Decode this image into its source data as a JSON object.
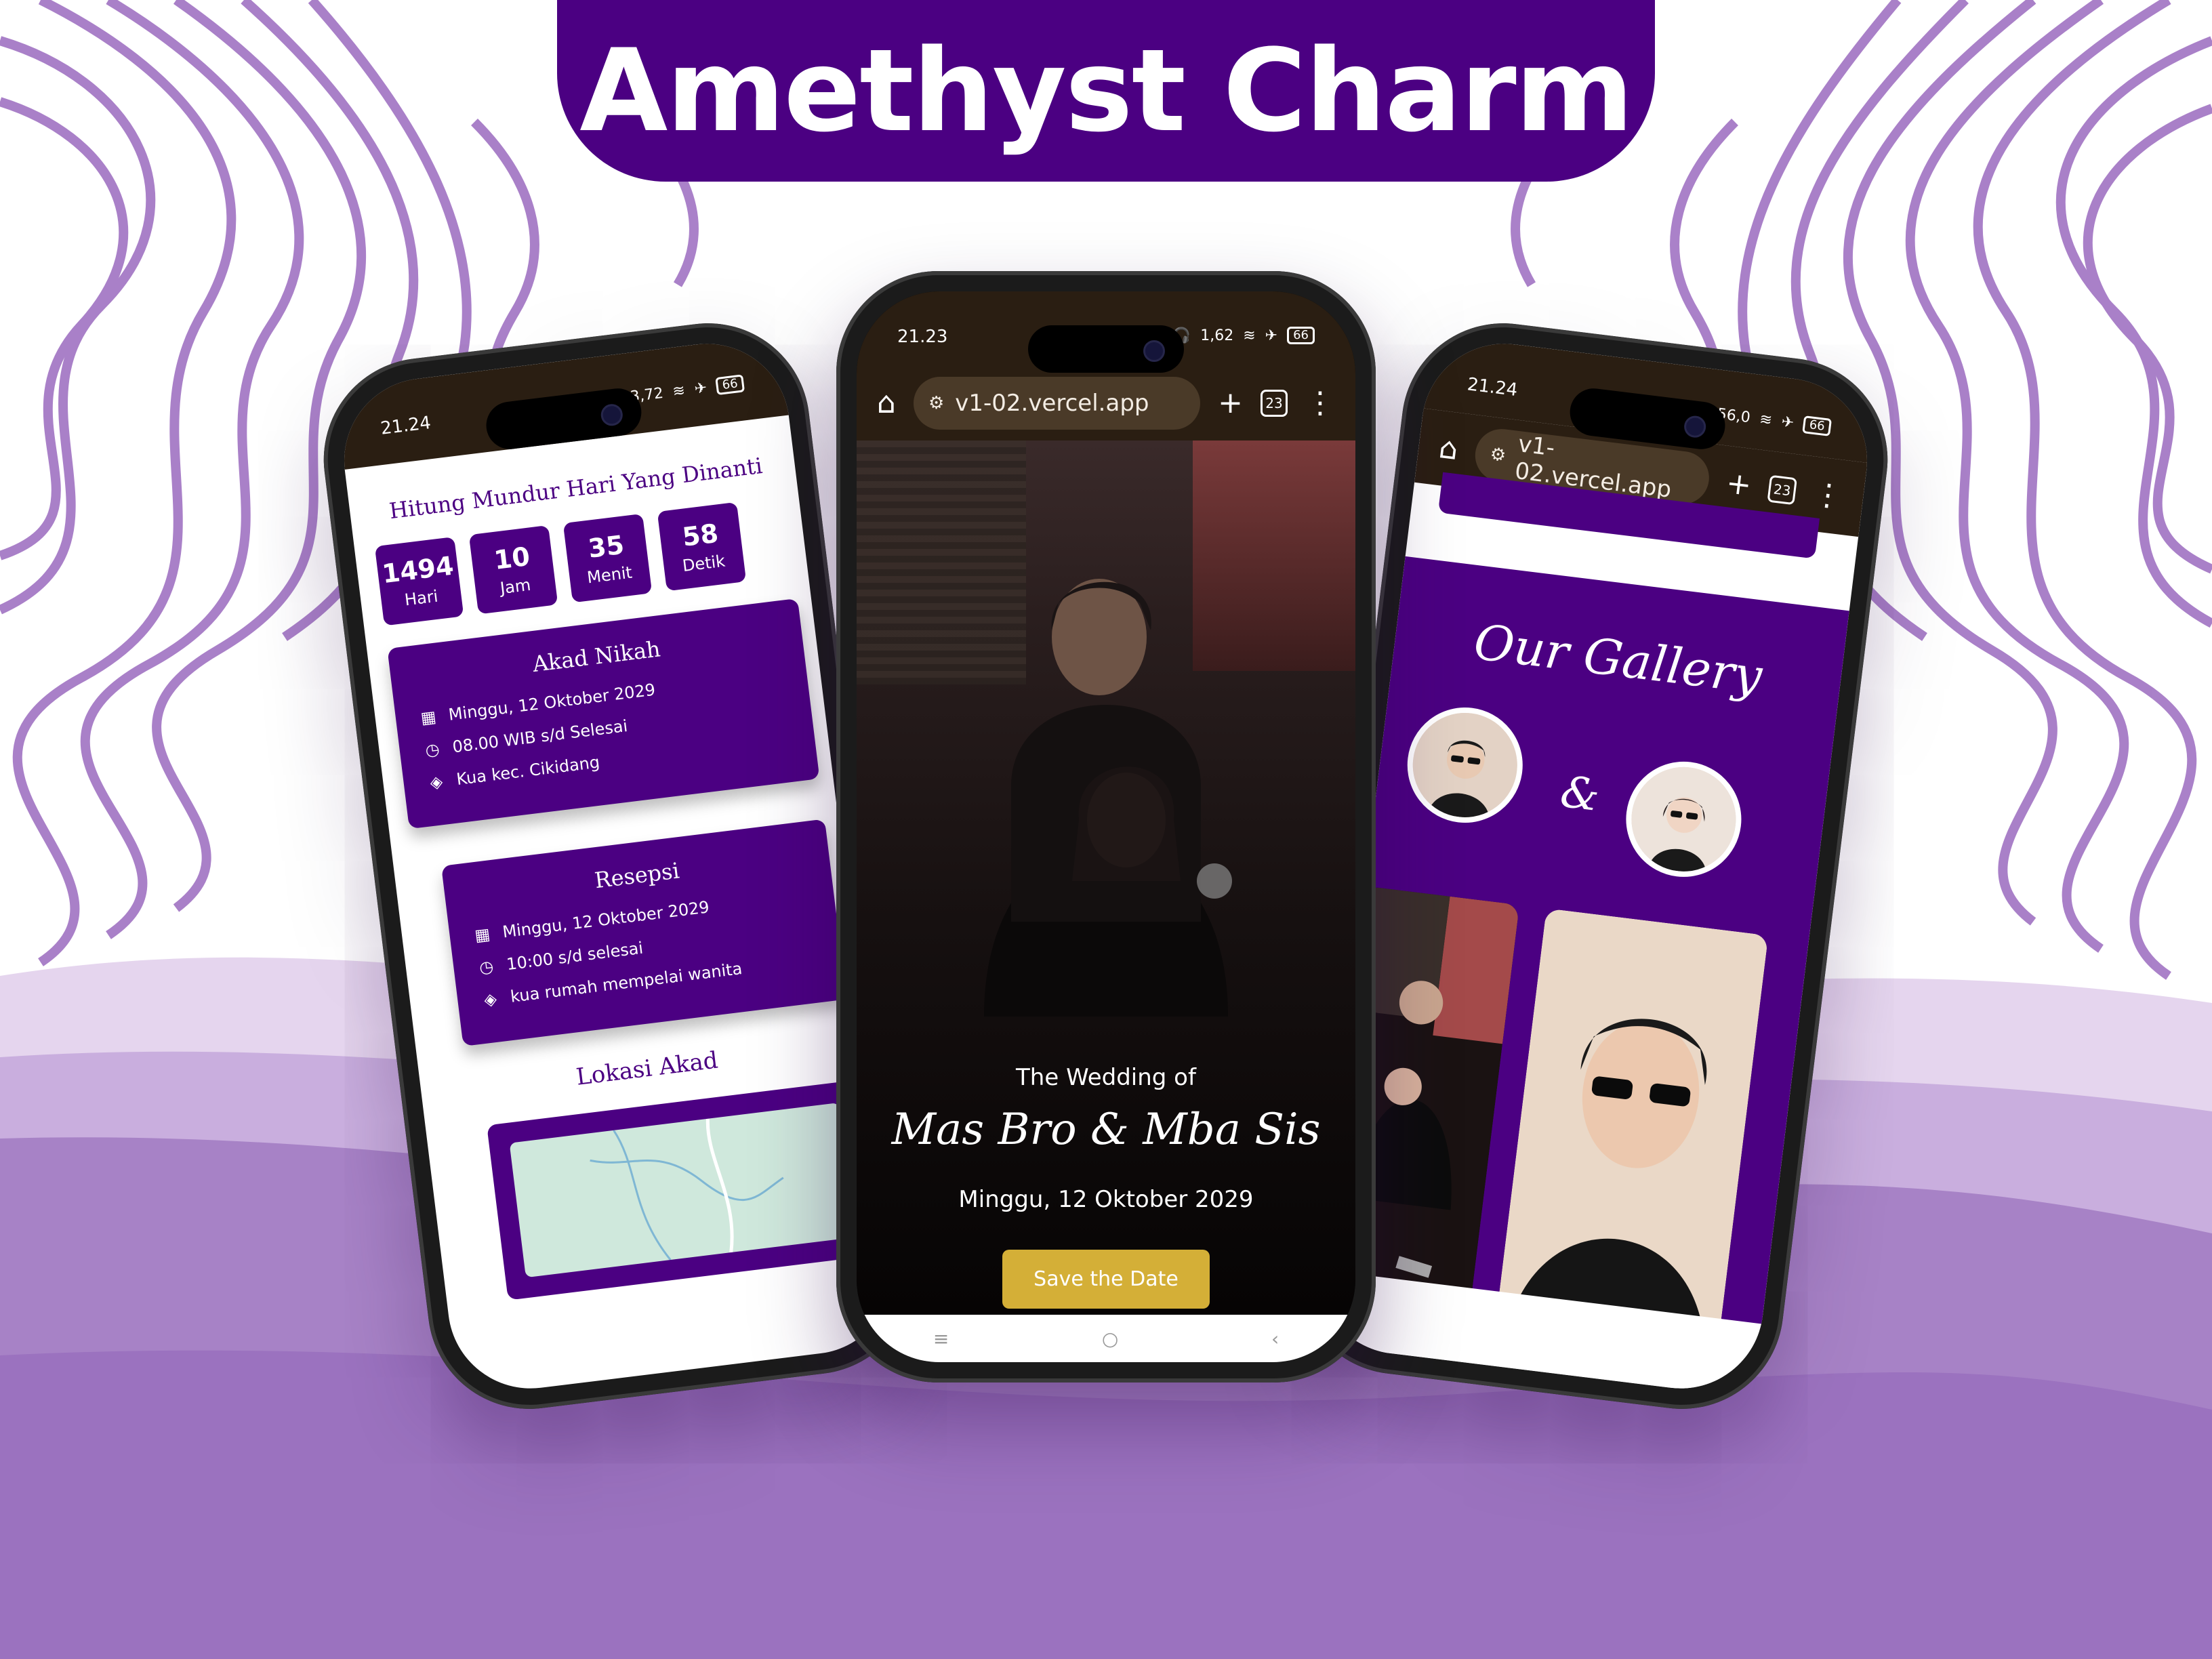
{
  "banner": {
    "title": "Amethyst Charm"
  },
  "colors": {
    "brand": "#4b0082",
    "gold": "#d4af37",
    "browser_bar": "#2a1e12"
  },
  "left_phone": {
    "status_time": "21.24",
    "countdown_title": "Hitung Mundur Hari Yang Dinanti",
    "countdown": [
      {
        "value": "1494",
        "label": "Hari"
      },
      {
        "value": "10",
        "label": "Jam"
      },
      {
        "value": "35",
        "label": "Menit"
      },
      {
        "value": "58",
        "label": "Detik"
      }
    ],
    "akad": {
      "title": "Akad Nikah",
      "date": "Minggu, 12 Oktober 2029",
      "time": "08.00 WIB s/d Selesai",
      "place": "Kua kec. Cikidang"
    },
    "resepsi": {
      "title": "Resepsi",
      "date": "Minggu, 12 Oktober 2029",
      "time": "10:00 s/d selesai",
      "place": "kua rumah mempelai wanita"
    },
    "lokasi_title": "Lokasi Akad"
  },
  "center_phone": {
    "status_time": "21.23",
    "status_speed": "1,62",
    "battery": "66",
    "url": "v1-02.vercel.app",
    "tab_count": "23",
    "wedding_of": "The Wedding of",
    "names": "Mas Bro & Mba Sis",
    "date": "Minggu, 12 Oktober 2029",
    "save_button": "Save the Date"
  },
  "right_phone": {
    "status_time": "21.24",
    "status_speed": "56,0",
    "battery": "66",
    "url": "v1-02.vercel.app",
    "tab_count": "23",
    "gallery_title": "Our Gallery",
    "ampersand": "&"
  },
  "left_status_speed": "3,72",
  "left_battery": "66"
}
